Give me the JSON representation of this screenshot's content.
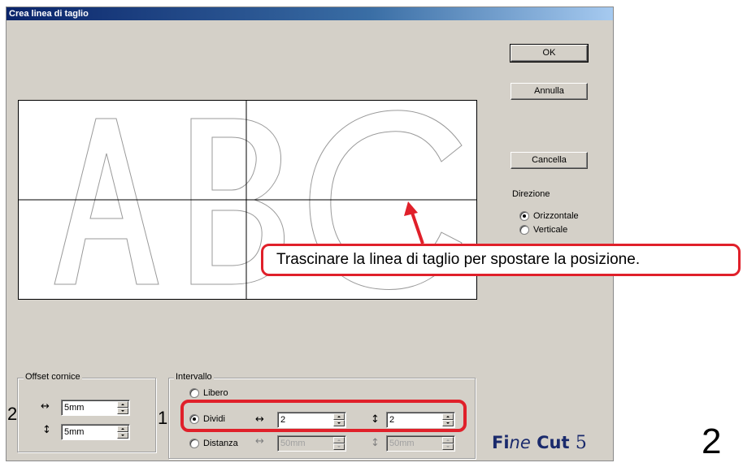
{
  "window": {
    "title": "Crea linea di taglio"
  },
  "buttons": {
    "ok": "OK",
    "cancel": "Annulla",
    "delete": "Cancella"
  },
  "preview": {
    "letters": "ABC"
  },
  "direction": {
    "title": "Direzione",
    "options": [
      {
        "label": "Orizzontale",
        "selected": true
      },
      {
        "label": "Verticale",
        "selected": false
      }
    ]
  },
  "offset": {
    "title": "Offset cornice",
    "horizontal": {
      "symbol": "↔",
      "value": "5mm"
    },
    "vertical": {
      "symbol": "↕",
      "value": "5mm"
    }
  },
  "interval": {
    "title": "Intervallo",
    "free": {
      "label": "Libero",
      "selected": false
    },
    "divide": {
      "label": "Dividi",
      "selected": true,
      "h_symbol": "↔",
      "h_value": "2",
      "v_symbol": "↕",
      "v_value": "2"
    },
    "distance": {
      "label": "Distanza",
      "selected": false,
      "h_symbol": "↔",
      "h_value": "50mm",
      "v_symbol": "↕",
      "v_value": "50mm"
    }
  },
  "annotations": {
    "callout": "Trascinare la linea di taglio per spostare la posizione.",
    "marker_1": "1",
    "marker_2": "2",
    "page_number": "2",
    "accent_color": "#e0202a"
  },
  "logo": {
    "part1": "Fi",
    "part2": "ne",
    "part3": " Cut ",
    "version": "5"
  }
}
